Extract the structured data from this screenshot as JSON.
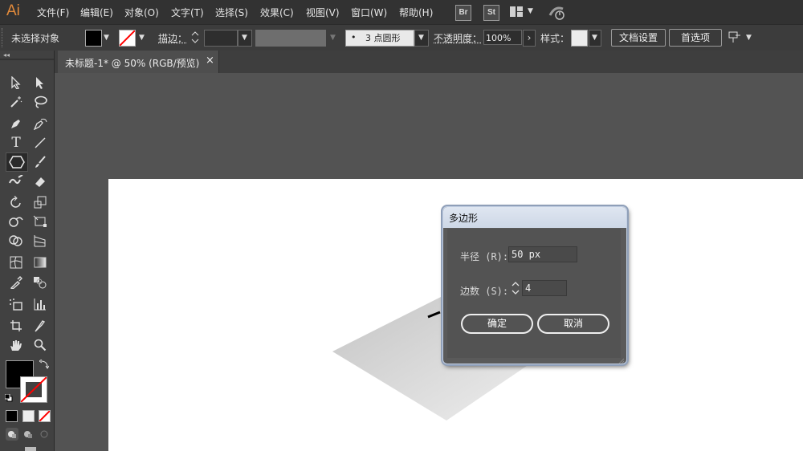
{
  "app": {
    "logo": "Ai"
  },
  "menu": [
    "文件(F)",
    "编辑(E)",
    "对象(O)",
    "文字(T)",
    "选择(S)",
    "效果(C)",
    "视图(V)",
    "窗口(W)",
    "帮助(H)"
  ],
  "toolbar_buttons": {
    "bridge": "Br",
    "stock": "St"
  },
  "control": {
    "selection_status": "未选择对象",
    "stroke_label": "描边：",
    "brush_label": "3 点圆形",
    "opacity_label": "不透明度：",
    "opacity_value": "100%",
    "style_label": "样式：",
    "doc_setup": "文档设置",
    "preferences": "首选项"
  },
  "tab": {
    "title": "未标题-1* @ 50% (RGB/预览)",
    "close": "×"
  },
  "dialog": {
    "title": "多边形",
    "radius_label": "半径 (R):",
    "radius_value": "50 px",
    "sides_label": "边数 (S):",
    "sides_value": "4",
    "ok": "确定",
    "cancel": "取消"
  },
  "colors": {
    "accent": "#e28a3b",
    "fill": "#000000",
    "stroke_none": "#ff0000"
  },
  "icons": [
    "selection-icon",
    "direct-selection-icon",
    "magic-wand-icon",
    "lasso-icon",
    "pen-icon",
    "curvature-icon",
    "type-icon",
    "line-icon",
    "polygon-icon",
    "paintbrush-icon",
    "shaper-icon",
    "eraser-icon",
    "rotate-icon",
    "scale-icon",
    "warp-icon",
    "free-transform-icon",
    "shape-builder-icon",
    "perspective-icon",
    "mesh-icon",
    "gradient-icon",
    "eyedropper-icon",
    "blend-icon",
    "symbol-sprayer-icon",
    "column-graph-icon",
    "artboard-icon",
    "slice-icon",
    "hand-icon",
    "zoom-icon"
  ]
}
